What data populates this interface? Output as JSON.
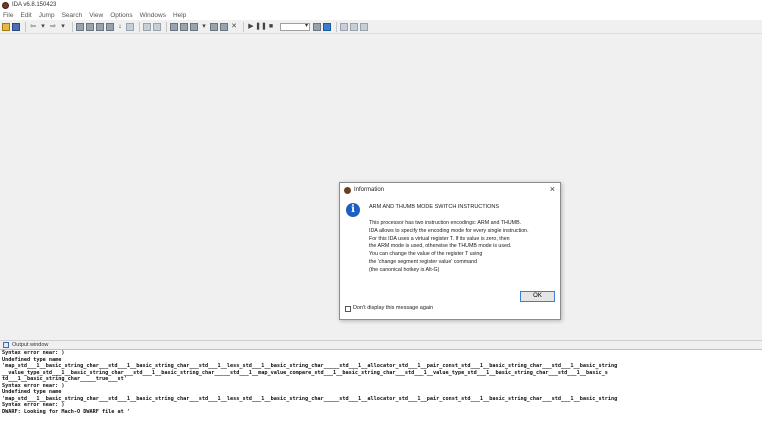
{
  "window": {
    "title": "IDA v6.8.150423"
  },
  "menu": [
    "File",
    "Edit",
    "Jump",
    "Search",
    "View",
    "Options",
    "Windows",
    "Help"
  ],
  "dialog": {
    "title": "Information",
    "close_glyph": "×",
    "heading": "ARM AND THUMB MODE SWITCH INSTRUCTIONS",
    "lines": [
      "This processor has two instruction encodings: ARM and THUMB.",
      "IDA allows to specify the encoding mode for every single instruction.",
      "For this IDA uses a virtual register T. If its value is zero, then",
      "the ARM mode is used, otherwise the THUMB mode is used.",
      "You can change the value of the register T using",
      "the 'change segment register value' command",
      "(the canonical hotkey is Alt-G)"
    ],
    "ok_label": "OK",
    "checkbox_label": "Don't display this message again",
    "checkbox_checked": false
  },
  "output": {
    "title": "Output window",
    "lines": [
      "Syntax error near: )",
      "Undefined type name",
      "'map_std___1__basic_string_char___std___1__basic_string_char___std___1__less_std___1__basic_string_char_____std___1__allocator_std___1__pair_const_std___1__basic_string_char___std___1__basic_string",
      "__value_type_std___1__basic_string_char___std___1__basic_string_char_____std___1__map_value_compare_std___1__basic_string_char___std___1__value_type_std___1__basic_string_char___std___1__basic_s",
      "td___1__basic_string_char_____true___st'",
      "Syntax error near: )",
      "Undefined type name",
      "'map_std___1__basic_string_char___std___1__basic_string_char___std___1__less_std___1__basic_string_char_____std___1__allocator_std___1__pair_const_std___1__basic_string_char___std___1__basic_string",
      "Syntax error near: )",
      "DWARF: Looking for Mach-O DWARF file at '"
    ]
  }
}
